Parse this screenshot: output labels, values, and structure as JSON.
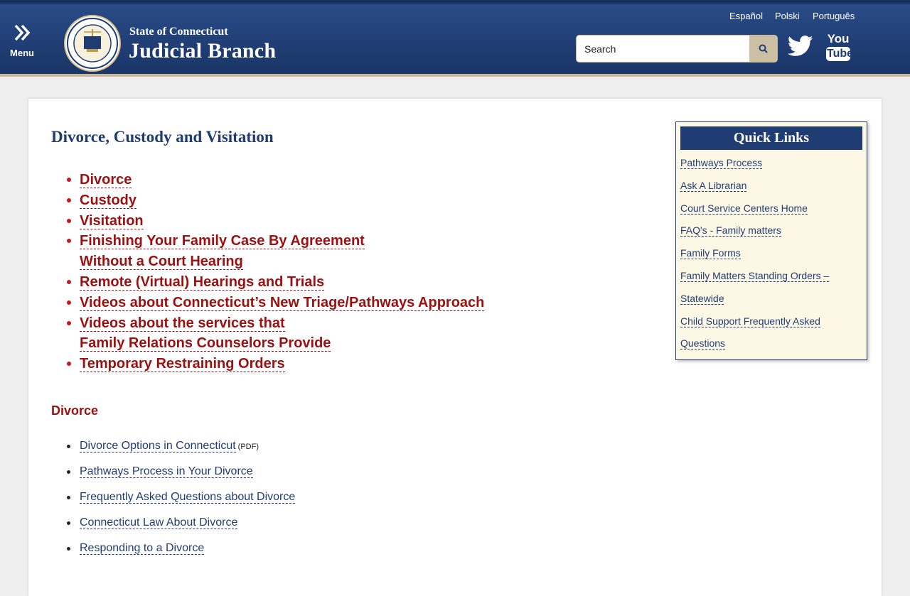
{
  "header": {
    "menu_label": "Menu",
    "brand_top": "State of Connecticut",
    "brand_main": "Judicial Branch",
    "languages": [
      "Español",
      "Polski",
      "Português"
    ],
    "search_placeholder": "Search",
    "youtube_you": "You",
    "youtube_tube": "Tube"
  },
  "main": {
    "title": "Divorce, Custody and Visitation",
    "toc": [
      "Divorce",
      "Custody",
      "Visitation",
      "Finishing Your Family Case By Agreement",
      "Without a Court Hearing",
      "Remote (Virtual) Hearings and Trials",
      "Videos about Connecticut’s New Triage/Pathways Approach",
      "Videos about the services that",
      "Family Relations Counselors Provide",
      "Temporary Restraining Orders"
    ],
    "section_heading": "Divorce",
    "divorce_links": [
      "Divorce Options in Connecticut",
      "Pathways Process in Your Divorce",
      "Frequently Asked Questions about Divorce",
      "Connecticut Law About Divorce",
      "Responding to a Divorce"
    ],
    "pdf_label": "(PDF)"
  },
  "quick_links": {
    "title": "Quick Links",
    "items": [
      "Pathways Process",
      "Ask A Librarian",
      "Court Service Centers Home",
      "FAQ's - Family matters",
      "Family Forms",
      "Family Matters Standing Orders –",
      "Statewide",
      "Child Support Frequently Asked",
      "Questions"
    ]
  },
  "colors": {
    "header_blue": "#1f3d73",
    "link_red": "#9b1010",
    "link_blue": "#1f3d73",
    "quick_bg": "#fdf8e6",
    "search_button": "#cdbfa3"
  },
  "icons": [
    "menu-chevron-icon",
    "judicial-seal-logo",
    "search-icon",
    "twitter-icon",
    "youtube-icon"
  ]
}
